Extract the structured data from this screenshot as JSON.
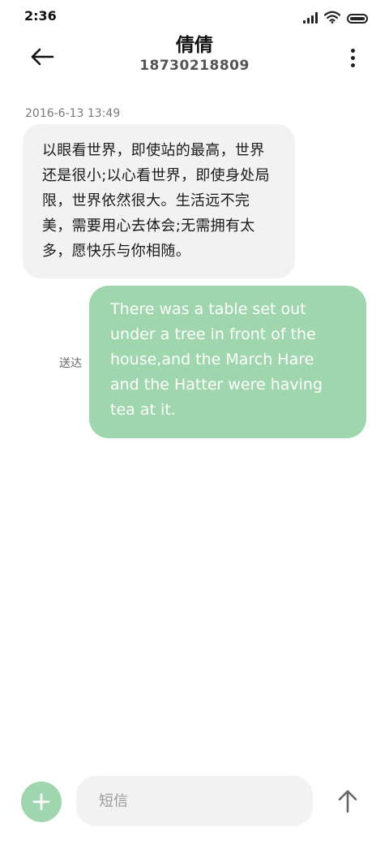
{
  "status_bar": {
    "time": "2:36",
    "icons": [
      "signal-icon",
      "wifi-icon",
      "battery-icon"
    ]
  },
  "header": {
    "back_icon": "back-arrow-icon",
    "contact_name": "倩倩",
    "contact_number": "18730218809",
    "more_icon": "more-vertical-icon"
  },
  "conversation": {
    "timestamp": "2016-6-13 13:49",
    "incoming": {
      "text": "以眼看世界，即使站的最高，世界还是很小;以心看世界，即使身处局限，世界依然很大。生活远不完美，需要用心去体会;无需拥有太多，愿快乐与你相随。"
    },
    "outgoing": {
      "text": "There was a table set out under a tree in front of the house,and the March Hare and the Hatter were having tea at it.",
      "status": "送达"
    }
  },
  "composer": {
    "add_icon": "plus-icon",
    "placeholder": "短信",
    "value": "",
    "send_icon": "send-arrow-icon"
  },
  "colors": {
    "accent": "#9fd6ae",
    "incoming_bubble": "#f2f2f2",
    "background": "#ffffff"
  }
}
